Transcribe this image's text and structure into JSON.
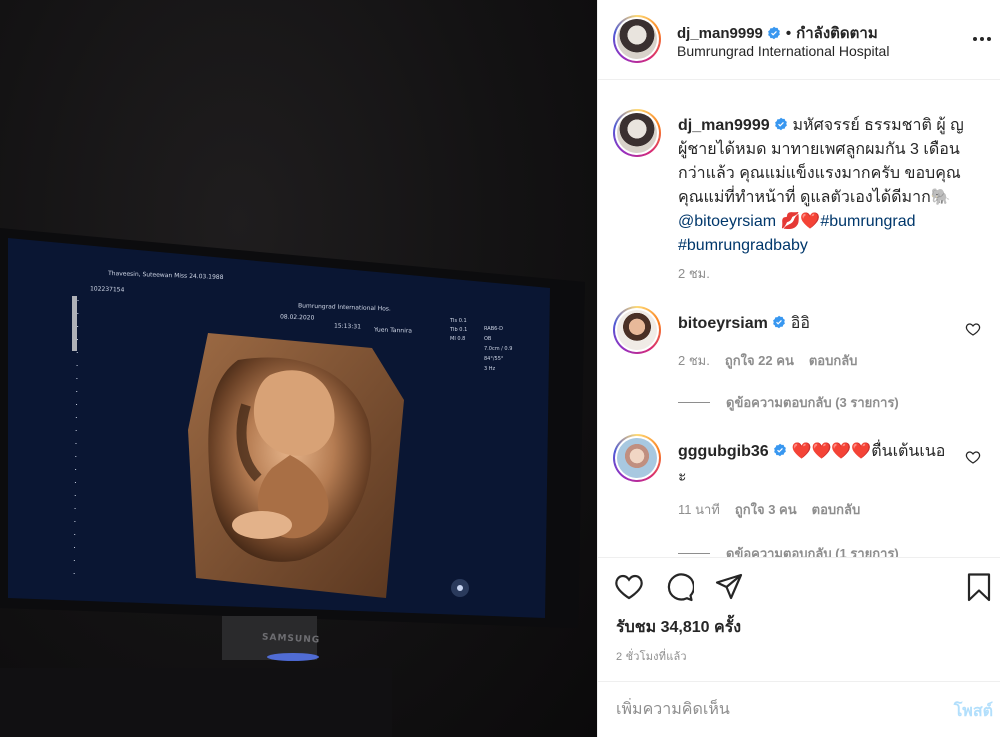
{
  "post": {
    "author": "dj_man9999",
    "separator": "•",
    "follow_state": "กำลังติดตาม",
    "location": "Bumrungrad International Hospital",
    "media": {
      "scan_name": "Thaveesin, Suteewan  Miss 24.03.1988",
      "scan_id": "102237154",
      "scan_hospital": "Bumrungrad International Hos.",
      "scan_date": "08.02.2020",
      "scan_time": "15:13:31",
      "scan_doctor": "Yuen Tannira",
      "tv_brand": "SAMSUNG"
    }
  },
  "caption": {
    "username": "dj_man9999",
    "text": " มหัศจรรย์ ธรรมชาติ ผู้ ญ ผู้ชายได้หมด มาทายเพศลูกผมกัน 3 เดือนกว่าแล้ว คุณแม่แข็งแรงมากครับ ขอบคุณคุณแม่ที่ทำหน้าที่ ดูแลตัวเองได้ดีมาก🐘 ",
    "mention": "@bitoeyrsiam",
    "emoji": " 💋❤️",
    "hashtag1": "#bumrungrad",
    "hashtag2": "#bumrungradbaby",
    "time": "2 ชม."
  },
  "comments": [
    {
      "username": "bitoeyrsiam",
      "text": " อิอิ",
      "time": "2 ชม.",
      "likes": "ถูกใจ 22 คน",
      "reply": "ตอบกลับ",
      "view_replies": "ดูข้อความตอบกลับ (3 รายการ)"
    },
    {
      "username": "gggubgib36",
      "text": " ❤️❤️❤️❤️ตื่นเต้นเนอะ",
      "time": "11 นาที",
      "likes": "ถูกใจ 3 คน",
      "reply": "ตอบกลับ",
      "view_replies": "ดูข้อความตอบกลับ (1 รายการ)"
    }
  ],
  "actions": {
    "views": "รับชม 34,810 ครั้ง",
    "timestamp": "2 ชั่วโมงที่แล้ว"
  },
  "add_comment": {
    "placeholder": "เพิ่มความคิดเห็น",
    "post_label": "โพสต์"
  },
  "colors": {
    "text": "#262626",
    "muted": "#8e8e8e",
    "link": "#00376b",
    "verified": "#3897f0",
    "post_disabled": "#b2dffc"
  },
  "icons": [
    "heart-icon",
    "comment-icon",
    "share-icon",
    "bookmark-icon",
    "more-icon",
    "verified-icon"
  ]
}
